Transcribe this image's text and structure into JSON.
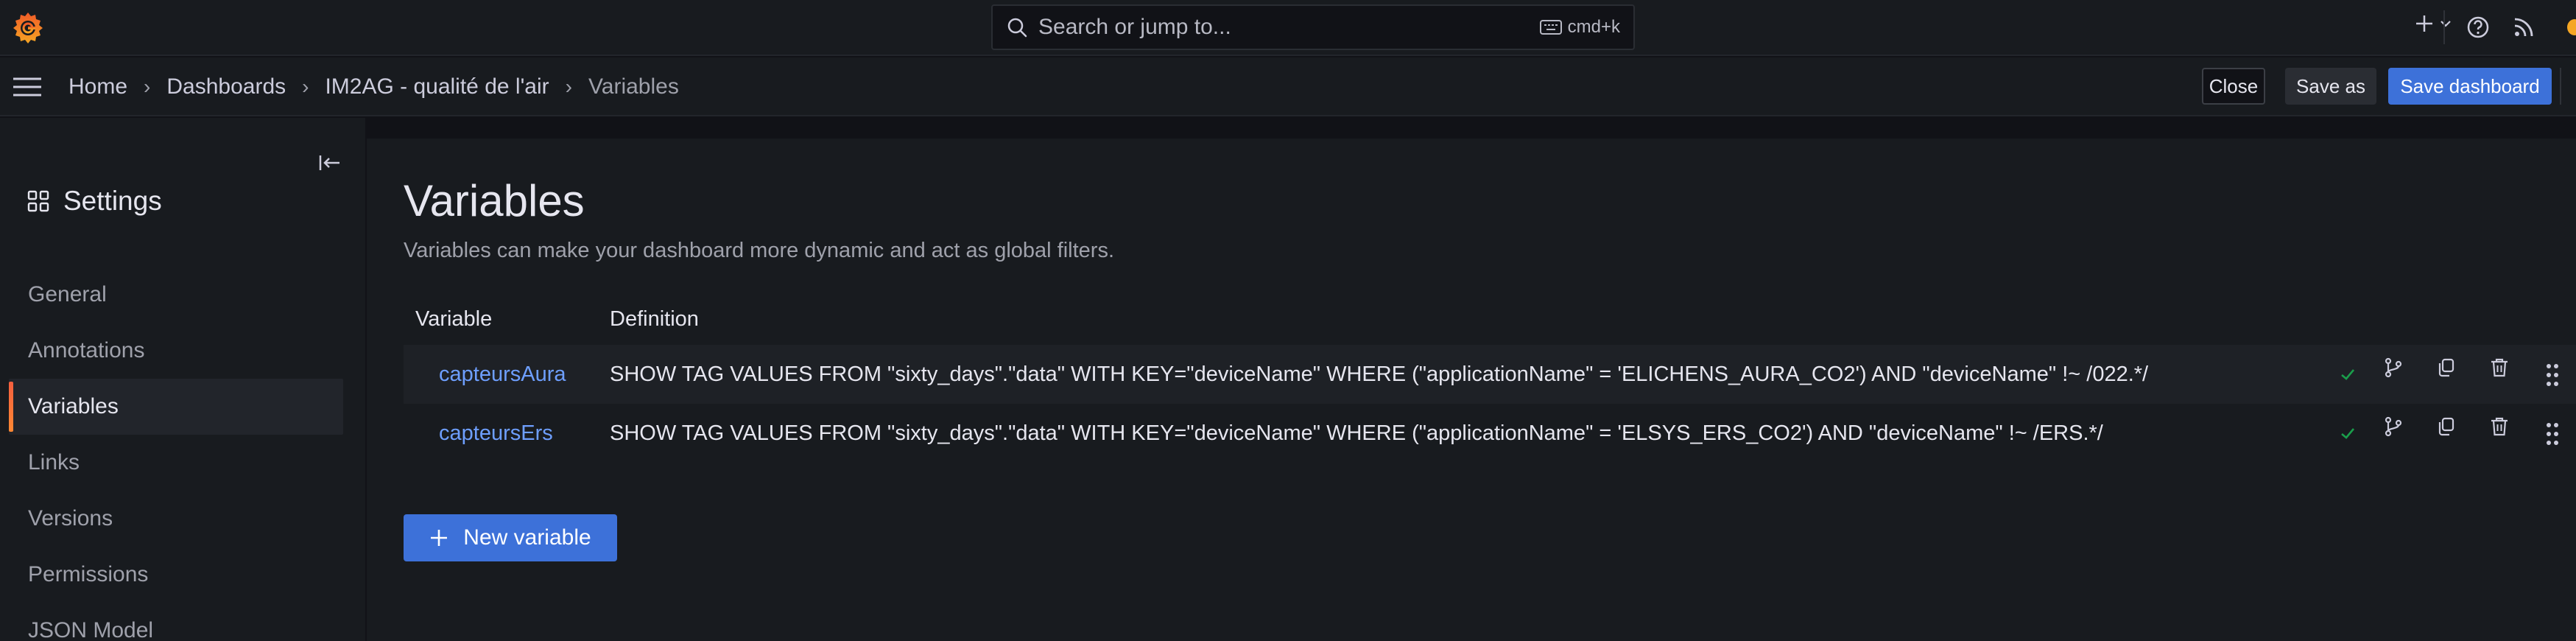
{
  "search": {
    "placeholder": "Search or jump to...",
    "shortcut": "cmd+k"
  },
  "breadcrumb": [
    {
      "label": "Home"
    },
    {
      "label": "Dashboards"
    },
    {
      "label": "IM2AG - qualité de l'air"
    },
    {
      "label": "Variables"
    }
  ],
  "toolbar": {
    "close_label": "Close",
    "save_as_label": "Save as",
    "save_dashboard_label": "Save dashboard"
  },
  "sidebar": {
    "title": "Settings",
    "items": [
      {
        "label": "General"
      },
      {
        "label": "Annotations"
      },
      {
        "label": "Variables",
        "active": true
      },
      {
        "label": "Links"
      },
      {
        "label": "Versions"
      },
      {
        "label": "Permissions"
      },
      {
        "label": "JSON Model"
      }
    ]
  },
  "main": {
    "title": "Variables",
    "description": "Variables can make your dashboard more dynamic and act as global filters.",
    "columns": {
      "variable": "Variable",
      "definition": "Definition"
    },
    "rows": [
      {
        "name": "capteursAura",
        "definition": "SHOW TAG VALUES FROM \"sixty_days\".\"data\" WITH KEY=\"deviceName\" WHERE (\"applicationName\" = 'ELICHENS_AURA_CO2') AND \"deviceName\" !~ /022.*/"
      },
      {
        "name": "capteursErs",
        "definition": "SHOW TAG VALUES FROM \"sixty_days\".\"data\" WITH KEY=\"deviceName\" WHERE (\"applicationName\" = 'ELSYS_ERS_CO2') AND \"deviceName\" !~ /ERS.*/"
      }
    ],
    "new_variable_label": "New variable"
  },
  "colors": {
    "accent": "#3d71d9",
    "active_bar": "#f55f3e",
    "link": "#6e9fff",
    "ok": "#1a9e4b"
  }
}
